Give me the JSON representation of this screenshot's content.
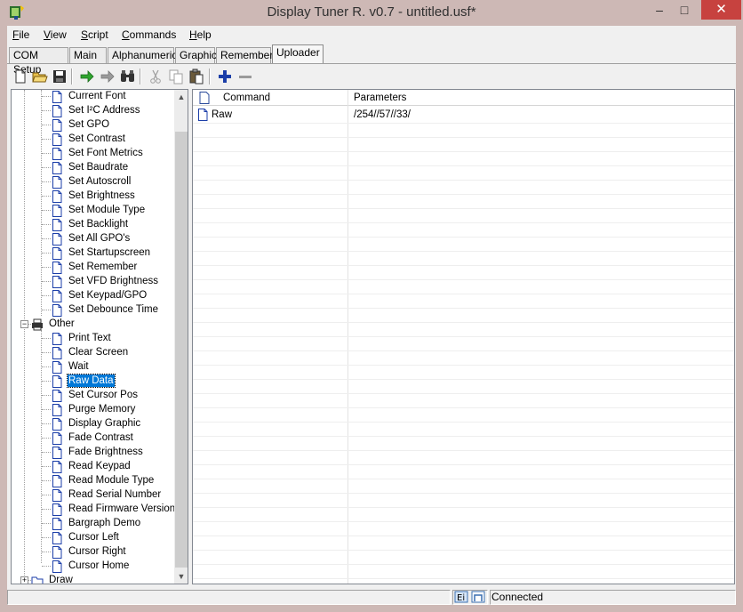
{
  "window": {
    "title": "Display Tuner R. v0.7 - untitled.usf*"
  },
  "menu": [
    {
      "pre": "",
      "ul": "F",
      "post": "ile"
    },
    {
      "pre": "",
      "ul": "V",
      "post": "iew"
    },
    {
      "pre": "",
      "ul": "S",
      "post": "cript"
    },
    {
      "pre": "",
      "ul": "C",
      "post": "ommands"
    },
    {
      "pre": "",
      "ul": "H",
      "post": "elp"
    }
  ],
  "tabs": [
    "COM Setup",
    "Main",
    "Alphanumeric",
    "Graphic",
    "Remember",
    "Uploader"
  ],
  "active_tab": "Uploader",
  "toolbar_icons": [
    "new-icon",
    "open-icon",
    "save-icon",
    "run-icon",
    "step-icon",
    "find-icon",
    "cut-icon",
    "copy-icon",
    "paste-icon",
    "add-icon",
    "remove-icon"
  ],
  "tree": {
    "set_items": [
      "Current Font",
      "Set I²C Address",
      "Set GPO",
      "Set Contrast",
      "Set Font Metrics",
      "Set Baudrate",
      "Set Autoscroll",
      "Set Brightness",
      "Set Module Type",
      "Set Backlight",
      "Set All GPO's",
      "Set Startupscreen",
      "Set Remember",
      "Set VFD Brightness",
      "Set Keypad/GPO",
      "Set Debounce Time"
    ],
    "other_label": "Other",
    "other_items": [
      "Print Text",
      "Clear Screen",
      "Wait",
      "Raw Data",
      "Set Cursor Pos",
      "Purge Memory",
      "Display Graphic",
      "Fade Contrast",
      "Fade Brightness",
      "Read Keypad",
      "Read Module Type",
      "Read Serial Number",
      "Read Firmware Version",
      "Bargraph Demo",
      "Cursor Left",
      "Cursor Right",
      "Cursor Home"
    ],
    "selected": "Raw Data",
    "draw_label": "Draw"
  },
  "grid": {
    "columns": [
      "Command",
      "Parameters"
    ],
    "rows": [
      {
        "command": "Raw",
        "parameters": "/254//57//33/"
      }
    ]
  },
  "status": {
    "connection": "Connected"
  },
  "colors": {
    "selection": "#0078d7",
    "titlebar": "#cdb8b5",
    "close": "#c7423f"
  }
}
